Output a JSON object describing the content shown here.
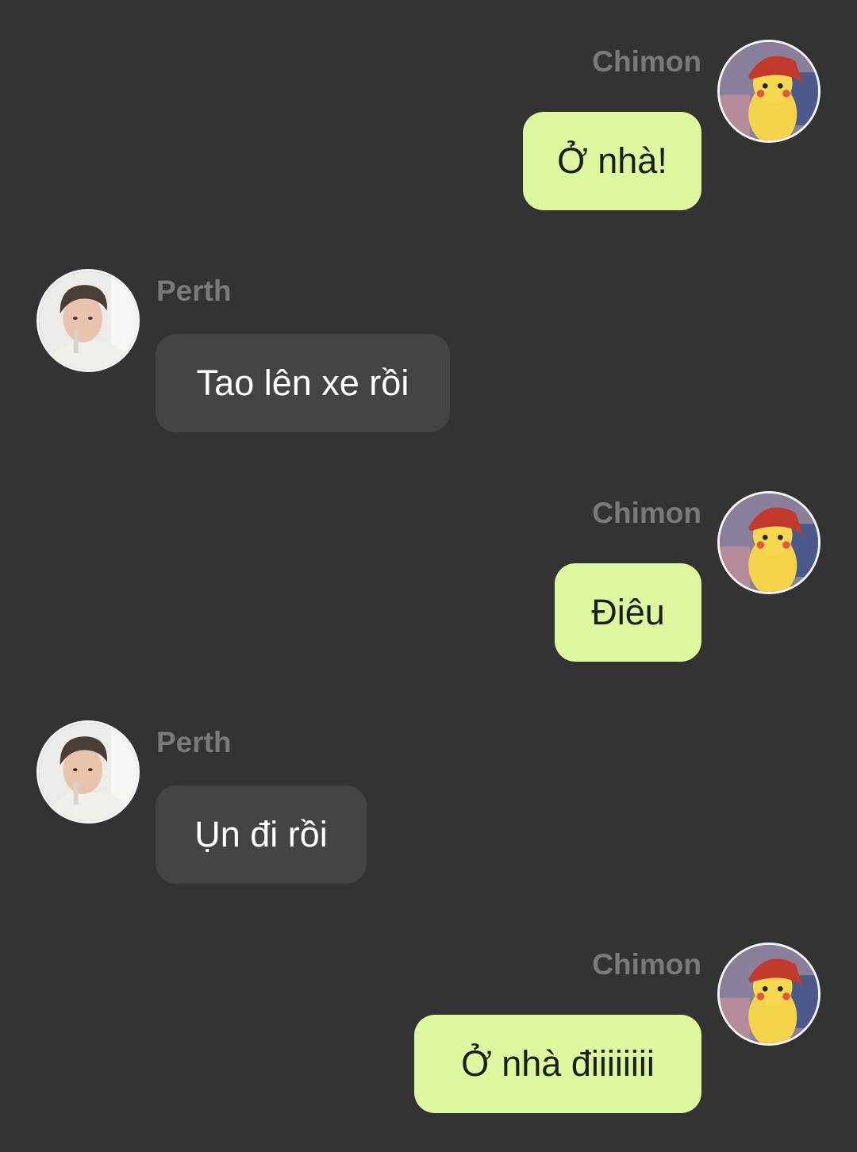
{
  "conversation": {
    "messages": [
      {
        "sender": "Chimon",
        "direction": "outgoing",
        "text": "Ở nhà!"
      },
      {
        "sender": "Perth",
        "direction": "incoming",
        "text": "Tao lên xe rồi"
      },
      {
        "sender": "Chimon",
        "direction": "outgoing",
        "text": "Điêu"
      },
      {
        "sender": "Perth",
        "direction": "incoming",
        "text": "Ụn đi rồi"
      },
      {
        "sender": "Chimon",
        "direction": "outgoing",
        "text": "Ở nhà điiiiiiii"
      }
    ]
  },
  "colors": {
    "background": "#333333",
    "outgoing_bubble": "#dcf79e",
    "incoming_bubble": "#444444",
    "sender_name": "#7a7a7a"
  },
  "icons": {
    "chimon_avatar": "pikachu-avatar-icon",
    "perth_avatar": "person-photo-avatar-icon"
  }
}
